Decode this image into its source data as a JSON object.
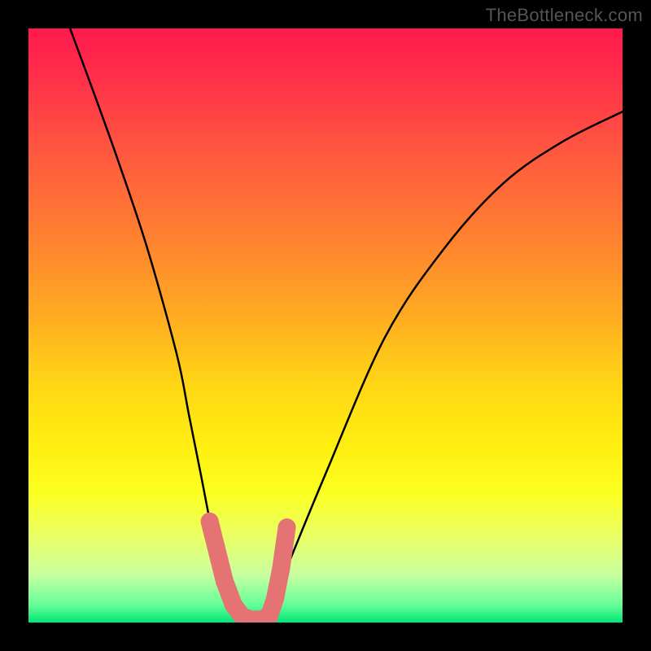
{
  "watermark": "TheBottleneck.com",
  "chart_data": {
    "type": "line",
    "title": "",
    "xlabel": "",
    "ylabel": "",
    "xlim": [
      0,
      100
    ],
    "ylim": [
      0,
      100
    ],
    "series": [
      {
        "name": "bottleneck-curve",
        "x": [
          7,
          10,
          15,
          20,
          25,
          27,
          29,
          31,
          33,
          35,
          37,
          39,
          41,
          43,
          50,
          60,
          70,
          80,
          90,
          100
        ],
        "y": [
          100,
          92,
          78,
          63,
          45,
          35,
          25,
          15,
          8,
          3,
          0,
          0,
          3,
          8,
          25,
          48,
          63,
          74,
          81,
          86
        ]
      }
    ],
    "markers": {
      "name": "highlight-range",
      "x": [
        30.5,
        31.5,
        33,
        34.5,
        36,
        37.5,
        39,
        40.5,
        41.5,
        42.5,
        43.5
      ],
      "y": [
        17,
        13,
        7,
        3,
        1,
        0.5,
        0.5,
        1,
        4,
        9,
        16
      ]
    },
    "gradient_stops": [
      {
        "pos": 0,
        "color": "#ff1a4d"
      },
      {
        "pos": 50,
        "color": "#ffd615"
      },
      {
        "pos": 80,
        "color": "#fbff20"
      },
      {
        "pos": 100,
        "color": "#00e676"
      }
    ]
  }
}
